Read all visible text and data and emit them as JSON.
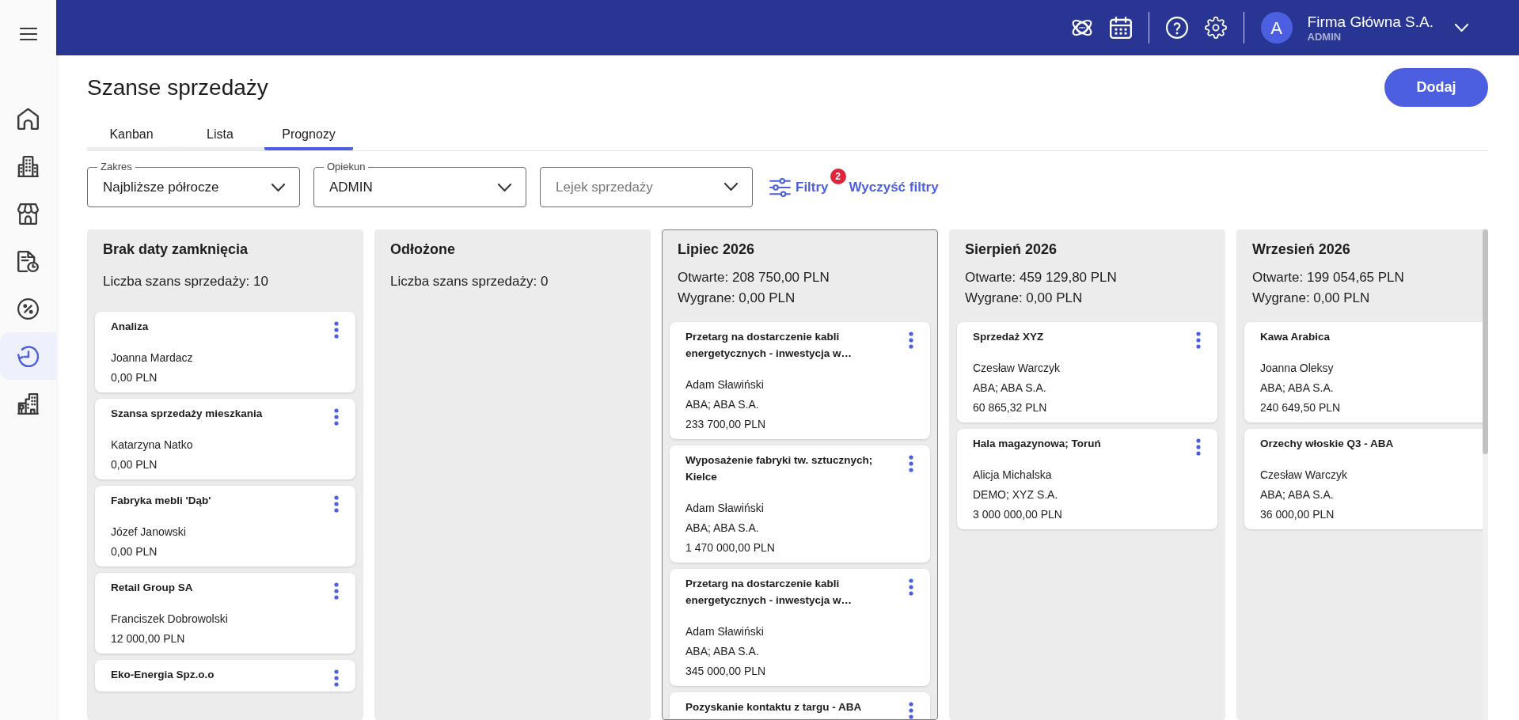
{
  "sidebar": {
    "items": [
      {
        "selected": false
      },
      {
        "selected": false
      },
      {
        "selected": false
      },
      {
        "selected": false
      },
      {
        "selected": false
      },
      {
        "selected": true
      },
      {
        "selected": false
      }
    ]
  },
  "top_bar": {
    "avatar_letter": "A",
    "company": "Firma Główna S.A.",
    "user": "ADMIN"
  },
  "page": {
    "title": "Szanse sprzedaży",
    "add_button": "Dodaj"
  },
  "tabs": [
    {
      "label": "Kanban",
      "selected": false
    },
    {
      "label": "Lista",
      "selected": false
    },
    {
      "label": "Prognozy",
      "selected": true
    }
  ],
  "filters": {
    "fields": [
      {
        "label": "Zakres",
        "value": "Najbliższe półrocze"
      },
      {
        "label": "Opiekun",
        "value": "ADMIN"
      },
      {
        "placeholder": "Lejek sprzedaży"
      }
    ],
    "filter_button": {
      "label": "Filtry",
      "badge": "2"
    },
    "clear_link": "Wyczyść filtry"
  },
  "columns": [
    {
      "title": "Brak daty zamknięcia",
      "highlighted": false,
      "summary": [
        "Liczba szans sprzedaży: 10"
      ],
      "cards": [
        {
          "title": "Analiza",
          "lines": [
            "Joanna Mardacz",
            "0,00 PLN"
          ],
          "menu": true
        },
        {
          "title": "Szansa sprzedaży mieszkania",
          "lines": [
            "Katarzyna Natko",
            "0,00 PLN"
          ],
          "menu": true
        },
        {
          "title": "Fabryka mebli 'Dąb'",
          "lines": [
            "Józef Janowski",
            "0,00 PLN"
          ],
          "menu": true
        },
        {
          "title": "Retail Group SA",
          "lines": [
            "Franciszek Dobrowolski",
            "12 000,00 PLN"
          ],
          "menu": true
        },
        {
          "title": "Eko-Energia Spz.o.o",
          "menu": true
        }
      ]
    },
    {
      "title": "Odłożone",
      "highlighted": false,
      "summary": [
        "Liczba szans sprzedaży: 0"
      ]
    },
    {
      "title": "Lipiec 2026",
      "highlighted": true,
      "summary": [
        "Otwarte: 208 750,00 PLN",
        "Wygrane: 0,00 PLN"
      ],
      "cards": [
        {
          "title": "Przetarg na dostarczenie kabli energetycznych - inwestycja w…",
          "lines": [
            "Adam Sławiński",
            "ABA; ABA S.A.",
            "233 700,00 PLN"
          ],
          "menu": true
        },
        {
          "title": "Wyposażenie fabryki tw. sztucznych; Kielce",
          "lines": [
            "Adam Sławiński",
            "ABA; ABA S.A.",
            "1 470 000,00 PLN"
          ],
          "menu": true
        },
        {
          "title": "Przetarg na dostarczenie kabli energetycznych - inwestycja w…",
          "lines": [
            "Adam Sławiński",
            "ABA; ABA S.A.",
            "345 000,00 PLN"
          ],
          "menu": true
        },
        {
          "title": "Pozyskanie kontaktu z targu - ABA",
          "menu": true
        }
      ]
    },
    {
      "title": "Sierpień 2026",
      "highlighted": false,
      "summary": [
        "Otwarte: 459 129,80 PLN",
        "Wygrane: 0,00 PLN"
      ],
      "cards": [
        {
          "title": "Sprzedaż XYZ",
          "lines": [
            "Czesław Warczyk",
            "ABA; ABA S.A.",
            "60 865,32 PLN"
          ],
          "menu": true
        },
        {
          "title": "Hala magazynowa; Toruń",
          "lines": [
            "Alicja Michalska",
            "DEMO; XYZ S.A.",
            "3 000 000,00 PLN"
          ],
          "menu": true
        }
      ]
    },
    {
      "title": "Wrzesień 2026",
      "highlighted": false,
      "summary": [
        "Otwarte: 199 054,65 PLN",
        "Wygrane: 0,00 PLN"
      ],
      "cards": [
        {
          "title": "Kawa Arabica",
          "lines": [
            "Joanna Oleksy",
            "ABA; ABA S.A.",
            "240 649,50 PLN"
          ],
          "menu": false
        },
        {
          "title": "Orzechy włoskie Q3 - ABA",
          "lines": [
            "Czesław Warczyk",
            "ABA; ABA S.A.",
            "36 000,00 PLN"
          ],
          "menu": false
        }
      ]
    }
  ]
}
